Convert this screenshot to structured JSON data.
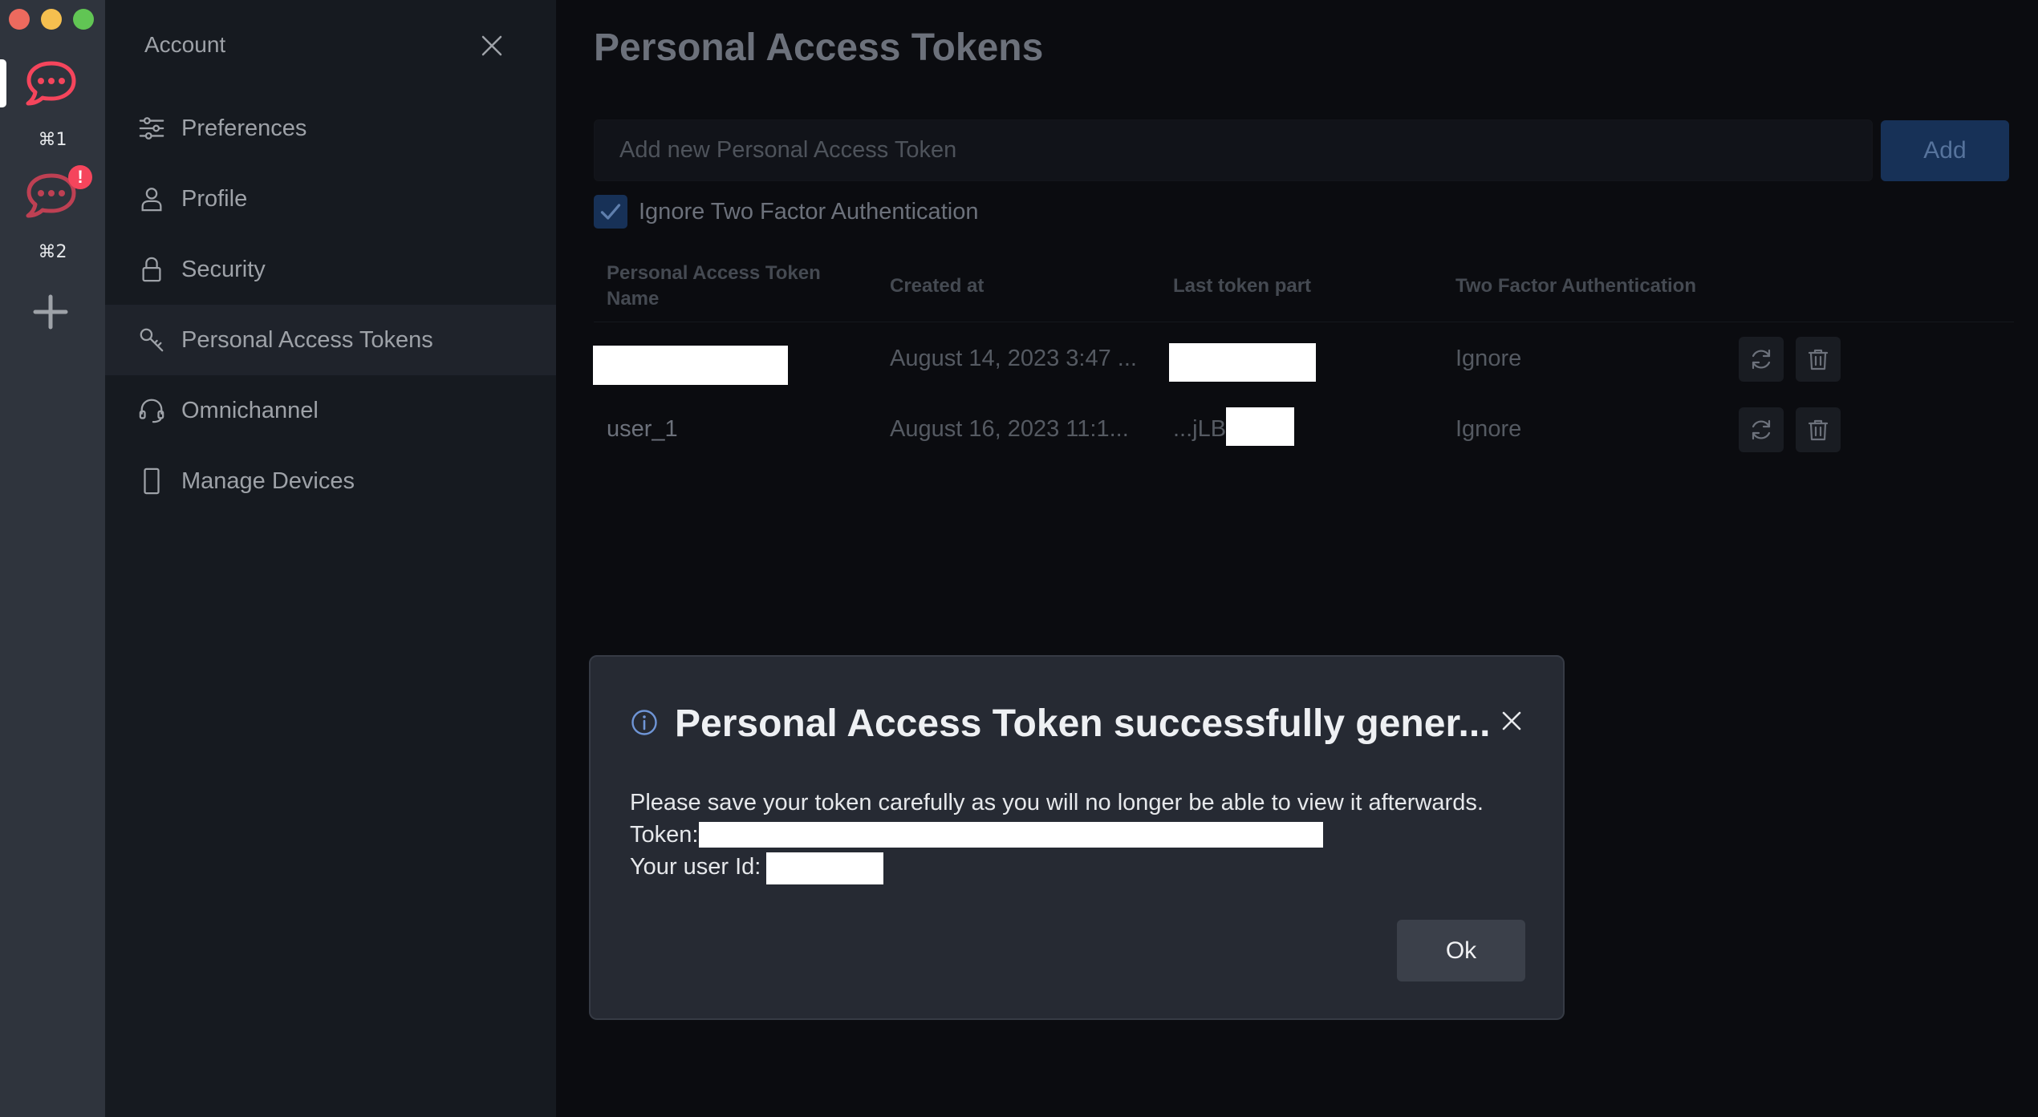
{
  "window": {
    "traffic_lights": [
      "close",
      "minimize",
      "zoom"
    ]
  },
  "servers": [
    {
      "icon": "rocketchat-logo-icon",
      "shortcut": "⌘1",
      "active": true
    },
    {
      "icon": "rocketchat-logo-icon",
      "shortcut": "⌘2",
      "active": false,
      "badge": "!"
    }
  ],
  "sidebar": {
    "title": "Account",
    "items": [
      {
        "label": "Preferences",
        "icon": "sliders-icon"
      },
      {
        "label": "Profile",
        "icon": "user-icon"
      },
      {
        "label": "Security",
        "icon": "lock-icon"
      },
      {
        "label": "Personal Access Tokens",
        "icon": "key-icon",
        "active": true
      },
      {
        "label": "Omnichannel",
        "icon": "headset-icon"
      },
      {
        "label": "Manage Devices",
        "icon": "mobile-icon"
      }
    ]
  },
  "main": {
    "title": "Personal Access Tokens",
    "input_placeholder": "Add new Personal Access Token",
    "add_label": "Add",
    "ignore_2fa_label": "Ignore Two Factor Authentication",
    "ignore_2fa_checked": true,
    "table": {
      "headers": [
        "Personal Access Token Name",
        "Created at",
        "Last token part",
        "Two Factor Authentication"
      ],
      "rows": [
        {
          "name": "",
          "created": "August 14, 2023 3:47 ...",
          "last_part": "",
          "two_factor": "Ignore"
        },
        {
          "name": "user_1",
          "created": "August 16, 2023 11:1...",
          "last_part": "...jLB",
          "two_factor": "Ignore"
        }
      ]
    }
  },
  "modal": {
    "title": "Personal Access Token successfully gener...",
    "message": "Please save your token carefully as you will no longer be able to view it afterwards.",
    "token_label": "Token:",
    "user_id_label": "Your user Id:",
    "ok_label": "Ok"
  },
  "colors": {
    "rail_bg": "#2f343d",
    "sidebar_bg": "#161a20",
    "main_bg": "#0b0c10",
    "brand_red": "#f5455c",
    "primary_blue": "#173157",
    "modal_bg": "#262a33"
  }
}
